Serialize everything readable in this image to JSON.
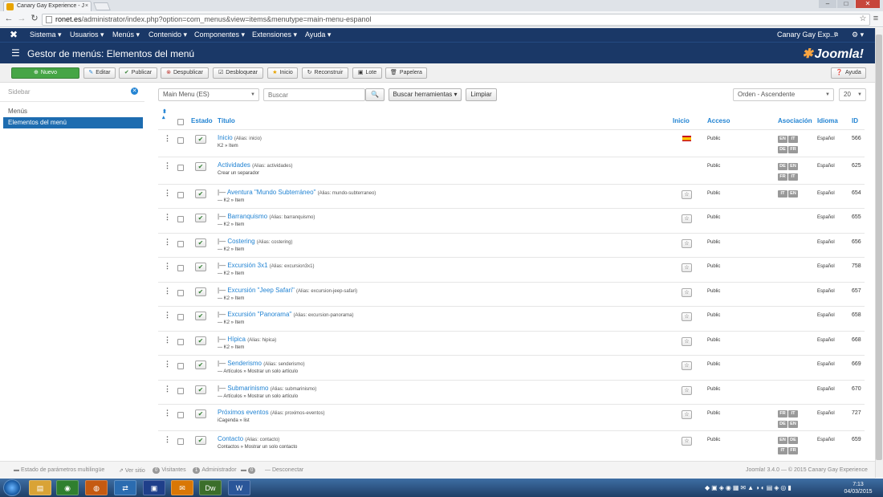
{
  "browser": {
    "tab_title": "Canary Gay Experience - J",
    "url_host": "ronet.es",
    "url_path": "/administrator/index.php?option=com_menus&view=items&menutype=main-menu-espanol",
    "win_min": "–",
    "win_max": "□",
    "win_close": "✕"
  },
  "topnav": {
    "items": [
      "Sistema ▾",
      "Usuarios ▾",
      "Menús ▾",
      "Contenido ▾",
      "Componentes ▾",
      "Extensiones ▾",
      "Ayuda ▾"
    ],
    "site_name": "Canary Gay Exp...",
    "user_menu": "⚙ ▾"
  },
  "header": {
    "title": "Gestor de menús: Elementos del menú",
    "logo_text": "Joomla!"
  },
  "toolbar": {
    "new": "Nuevo",
    "edit": "Editar",
    "publish": "Publicar",
    "unpublish": "Despublicar",
    "unlock": "Desbloquear",
    "home": "Inicio",
    "rebuild": "Reconstruir",
    "batch": "Lote",
    "trash": "Papelera",
    "help": "Ayuda"
  },
  "sidebar": {
    "heading": "Sidebar",
    "items": [
      "Menús",
      "Elementos del menú"
    ],
    "active_index": 1
  },
  "filters": {
    "menu_select": "Main Menu (ES)",
    "search_placeholder": "Buscar",
    "search_tools": "Buscar herramientas ▾",
    "clear": "Limpiar",
    "order": "Orden - Ascendente",
    "limit": "20"
  },
  "table": {
    "columns": {
      "status": "Estado",
      "title": "Título",
      "home": "Inicio",
      "access": "Acceso",
      "assoc": "Asociación",
      "lang": "Idioma",
      "id": "ID"
    },
    "rows": [
      {
        "prefix": "",
        "title": "Inicio",
        "alias": "(Alias: inicio)",
        "sub": "K2 » Item",
        "home": "flag",
        "access": "Public",
        "assoc": [
          "EN",
          "IT",
          "DE",
          "FR"
        ],
        "lang": "Español",
        "id": "566"
      },
      {
        "prefix": "",
        "title": "Actividades",
        "alias": "(Alias: actividades)",
        "sub": "Crear un separador",
        "home": "",
        "access": "Public",
        "assoc": [
          "DE",
          "EN",
          "FR",
          "IT"
        ],
        "lang": "Español",
        "id": "625"
      },
      {
        "prefix": "|— ",
        "title": "Aventura \"Mundo Subterráneo\"",
        "alias": "(Alias: mundo-subterraneo)",
        "sub": "— K2 » Item",
        "home": "star",
        "access": "Public",
        "assoc": [
          "IT",
          "EN"
        ],
        "lang": "Español",
        "id": "654"
      },
      {
        "prefix": "|— ",
        "title": "Barranquismo",
        "alias": "(Alias: barranquismo)",
        "sub": "— K2 » Item",
        "home": "star",
        "access": "Public",
        "assoc": [],
        "lang": "Español",
        "id": "655"
      },
      {
        "prefix": "|— ",
        "title": "Costering",
        "alias": "(Alias: costering)",
        "sub": "— K2 » Item",
        "home": "star",
        "access": "Public",
        "assoc": [],
        "lang": "Español",
        "id": "656"
      },
      {
        "prefix": "|— ",
        "title": "Excursión 3x1",
        "alias": "(Alias: excursion3x1)",
        "sub": "— K2 » Item",
        "home": "star",
        "access": "Public",
        "assoc": [],
        "lang": "Español",
        "id": "758"
      },
      {
        "prefix": "|— ",
        "title": "Excursión \"Jeep Safari\"",
        "alias": "(Alias: excursion-jeep-safari)",
        "sub": "— K2 » Item",
        "home": "star",
        "access": "Public",
        "assoc": [],
        "lang": "Español",
        "id": "657"
      },
      {
        "prefix": "|— ",
        "title": "Excursión \"Panorama\"",
        "alias": "(Alias: excursion-panorama)",
        "sub": "— K2 » Item",
        "home": "star",
        "access": "Public",
        "assoc": [],
        "lang": "Español",
        "id": "658"
      },
      {
        "prefix": "|— ",
        "title": "Hípica",
        "alias": "(Alias: hipica)",
        "sub": "— K2 » Item",
        "home": "star",
        "access": "Public",
        "assoc": [],
        "lang": "Español",
        "id": "668"
      },
      {
        "prefix": "|— ",
        "title": "Senderismo",
        "alias": "(Alias: senderismo)",
        "sub": "— Artículos » Mostrar un solo artículo",
        "home": "star",
        "access": "Public",
        "assoc": [],
        "lang": "Español",
        "id": "669"
      },
      {
        "prefix": "|— ",
        "title": "Submarinismo",
        "alias": "(Alias: submarinismo)",
        "sub": "— Artículos » Mostrar un solo artículo",
        "home": "star",
        "access": "Public",
        "assoc": [],
        "lang": "Español",
        "id": "670"
      },
      {
        "prefix": "",
        "title": "Próximos eventos",
        "alias": "(Alias: proximos-eventos)",
        "sub": "iCagenda » list",
        "home": "star",
        "access": "Public",
        "assoc": [
          "FR",
          "IT",
          "DE",
          "EN"
        ],
        "lang": "Español",
        "id": "727"
      },
      {
        "prefix": "",
        "title": "Contacto",
        "alias": "(Alias: contacto)",
        "sub": "Contactos » Mostrar un solo contacto",
        "home": "star",
        "access": "Public",
        "assoc": [
          "EN",
          "DE",
          "IT",
          "FR"
        ],
        "lang": "Español",
        "id": "659"
      }
    ]
  },
  "statusbar": {
    "multilang": "Estado de parámetros multilingüe",
    "view_site": "Ver sitio",
    "visitors_count": "0",
    "visitors": "Visitantes",
    "admins_count": "1",
    "admins": "Administrador",
    "messages_count": "0",
    "logout": "Desconectar",
    "version": "Joomla! 3.4.0 — © 2015 Canary Gay Experience"
  },
  "taskbar": {
    "time": "7:13",
    "date": "04/03/2015",
    "apps": [
      "Explorer",
      "Chrome",
      "Firefox",
      "Network",
      "Word viewer",
      "Outlook",
      "Dreamweaver",
      "Word"
    ],
    "app_glyphs": [
      "▤",
      "◉",
      "◍",
      "⇄",
      "▣",
      "✉",
      "Dw",
      "W"
    ]
  },
  "colors": {
    "nav": "#1a3867",
    "accent": "#2384d3",
    "new_button": "#46a546"
  }
}
